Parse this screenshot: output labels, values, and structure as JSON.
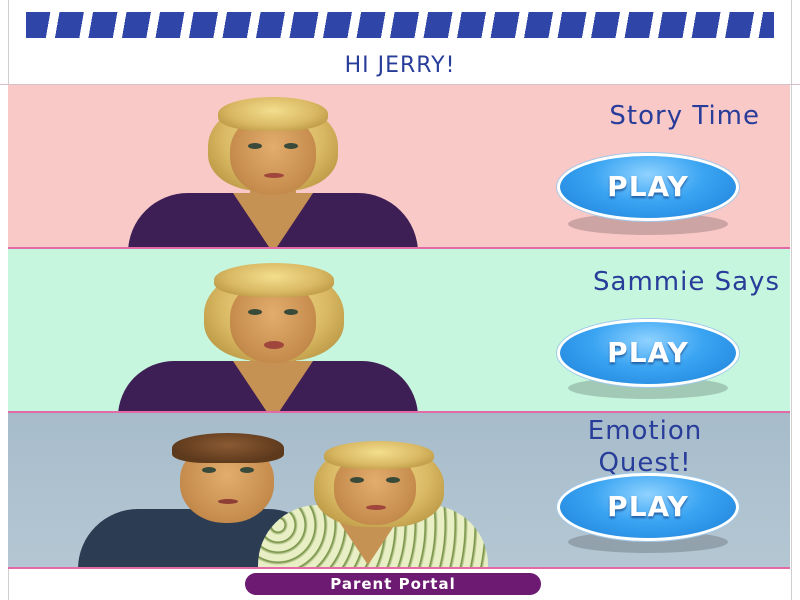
{
  "header": {
    "greeting": "HI JERRY!"
  },
  "panels": [
    {
      "title": "Story Time",
      "play_label": "PLAY",
      "background": "#f9c9c7"
    },
    {
      "title": "Sammie Says",
      "play_label": "PLAY",
      "background": "#c6f6dd"
    },
    {
      "title": "Emotion Quest!",
      "play_label": "PLAY",
      "background": "#aabfcd"
    }
  ],
  "footer": {
    "parent_portal_label": "Parent Portal"
  },
  "colors": {
    "stripe": "#2f45a8",
    "title_text": "#283c9a",
    "play_button": "#3aa4f2",
    "panel_divider": "#e36aa7",
    "parent_portal": "#6c1a72"
  },
  "icons": {
    "header_decoration": "blue-stripe-banner"
  }
}
